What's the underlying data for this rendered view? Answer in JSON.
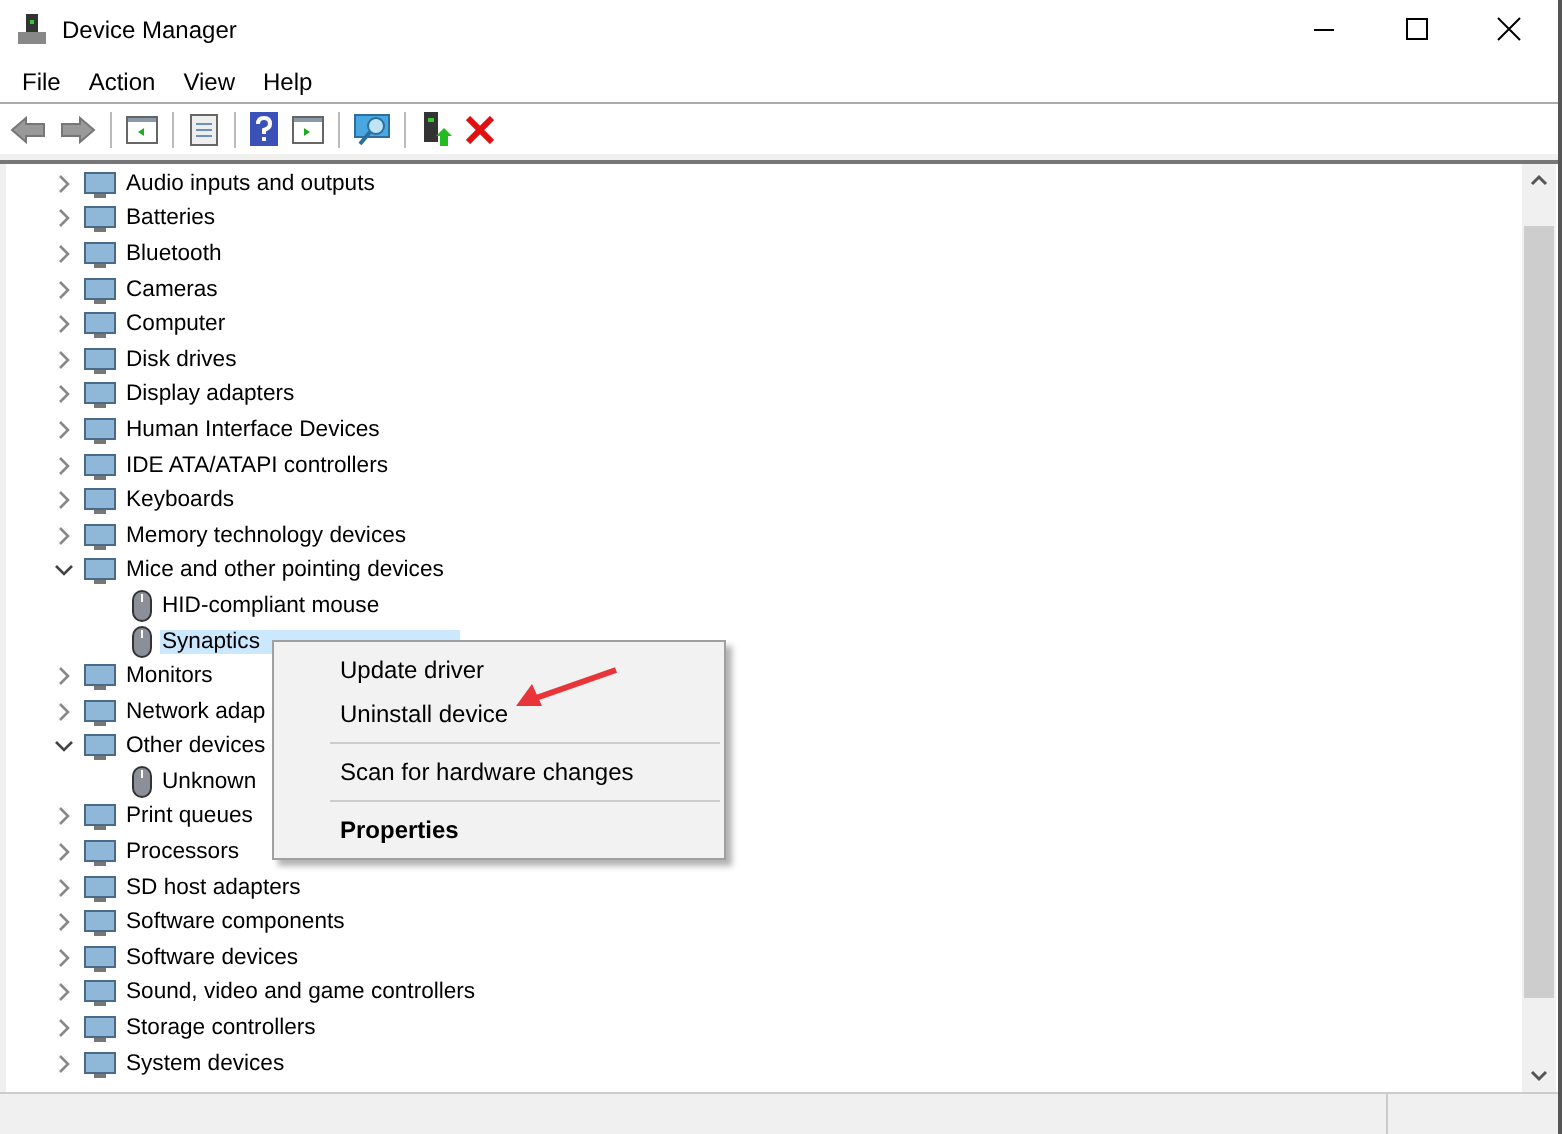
{
  "window": {
    "title": "Device Manager"
  },
  "menu_bar": [
    "File",
    "Action",
    "View",
    "Help"
  ],
  "tree": [
    {
      "label": "Audio inputs and outputs",
      "expanded": false,
      "selected": false
    },
    {
      "label": "Batteries",
      "expanded": false,
      "selected": false
    },
    {
      "label": "Bluetooth",
      "expanded": false,
      "selected": false
    },
    {
      "label": "Cameras",
      "expanded": false,
      "selected": false
    },
    {
      "label": "Computer",
      "expanded": false,
      "selected": false
    },
    {
      "label": "Disk drives",
      "expanded": false,
      "selected": false
    },
    {
      "label": "Display adapters",
      "expanded": false,
      "selected": false
    },
    {
      "label": "Human Interface Devices",
      "expanded": false,
      "selected": false
    },
    {
      "label": "IDE ATA/ATAPI controllers",
      "expanded": false,
      "selected": false
    },
    {
      "label": "Keyboards",
      "expanded": false,
      "selected": false
    },
    {
      "label": "Memory technology devices",
      "expanded": false,
      "selected": false
    },
    {
      "label": "Mice and other pointing devices",
      "expanded": true,
      "selected": false,
      "children": [
        {
          "label": "HID-compliant mouse",
          "selected": false
        },
        {
          "label": "Synaptics",
          "selected": true
        }
      ]
    },
    {
      "label": "Monitors",
      "expanded": false,
      "selected": false
    },
    {
      "label": "Network adap",
      "expanded": false,
      "selected": false
    },
    {
      "label": "Other devices",
      "expanded": true,
      "selected": false,
      "children": [
        {
          "label": "Unknown",
          "selected": false
        }
      ]
    },
    {
      "label": "Print queues",
      "expanded": false,
      "selected": false
    },
    {
      "label": "Processors",
      "expanded": false,
      "selected": false
    },
    {
      "label": "SD host adapters",
      "expanded": false,
      "selected": false
    },
    {
      "label": "Software components",
      "expanded": false,
      "selected": false
    },
    {
      "label": "Software devices",
      "expanded": false,
      "selected": false
    },
    {
      "label": "Sound, video and game controllers",
      "expanded": false,
      "selected": false
    },
    {
      "label": "Storage controllers",
      "expanded": false,
      "selected": false
    },
    {
      "label": "System devices",
      "expanded": false,
      "selected": false
    }
  ],
  "context_menu": [
    {
      "label": "Update driver",
      "kind": "item"
    },
    {
      "label": "Uninstall device",
      "kind": "item"
    },
    {
      "kind": "separator"
    },
    {
      "label": "Scan for hardware changes",
      "kind": "item"
    },
    {
      "kind": "separator"
    },
    {
      "label": "Properties",
      "kind": "default"
    }
  ]
}
